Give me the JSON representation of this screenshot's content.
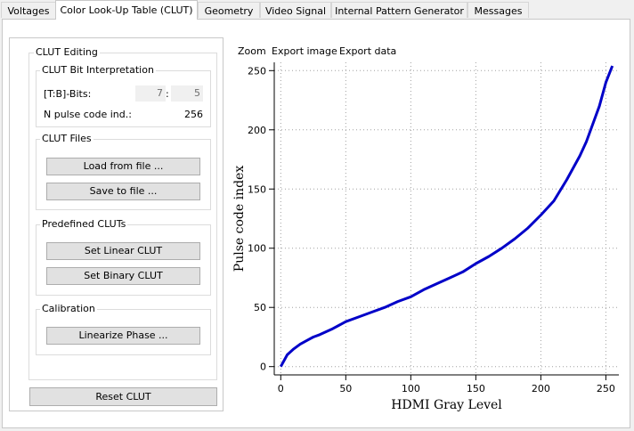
{
  "tabs": [
    "Voltages",
    "Color Look-Up Table (CLUT)",
    "Geometry",
    "Video Signal",
    "Internal Pattern Generator",
    "Messages"
  ],
  "clut_editing": {
    "title": "CLUT Editing",
    "bit_interp": {
      "title": "CLUT Bit Interpretation",
      "bits_label": "[T:B]-Bits:",
      "top_bits": "7",
      "separator": ":",
      "bottom_bits": "5",
      "n_label": "N pulse code ind.:",
      "n_value": "256"
    },
    "files": {
      "title": "CLUT Files",
      "load": "Load from file ...",
      "save": "Save to file ..."
    },
    "predefined": {
      "title": "Predefined CLUTs",
      "linear": "Set Linear CLUT",
      "binary": "Set Binary CLUT"
    },
    "calibration": {
      "title": "Calibration",
      "linearize": "Linearize Phase ..."
    },
    "reset": "Reset CLUT"
  },
  "plot_menu": {
    "zoom": "Zoom",
    "export_image": "Export image",
    "export_data": "Export data"
  },
  "chart_data": {
    "type": "line",
    "xlabel": "HDMI Gray Level",
    "ylabel": "Pulse code index",
    "xlim": [
      -5,
      260
    ],
    "ylim": [
      -7,
      257
    ],
    "xticks": [
      0,
      50,
      100,
      150,
      200,
      250
    ],
    "yticks": [
      0,
      50,
      100,
      150,
      200,
      250
    ],
    "grid": true,
    "color": "#0000c8",
    "series": [
      {
        "x": [
          0,
          5,
          10,
          15,
          20,
          25,
          30,
          40,
          50,
          60,
          70,
          80,
          90,
          100,
          110,
          120,
          130,
          140,
          150,
          160,
          170,
          180,
          190,
          200,
          210,
          220,
          230,
          235,
          240,
          245,
          250,
          255
        ],
        "y": [
          0,
          10,
          15,
          19,
          22,
          25,
          27,
          32,
          38,
          42,
          46,
          50,
          55,
          59,
          65,
          70,
          75,
          80,
          87,
          93,
          100,
          108,
          117,
          128,
          140,
          158,
          178,
          190,
          205,
          220,
          240,
          254
        ]
      }
    ]
  }
}
